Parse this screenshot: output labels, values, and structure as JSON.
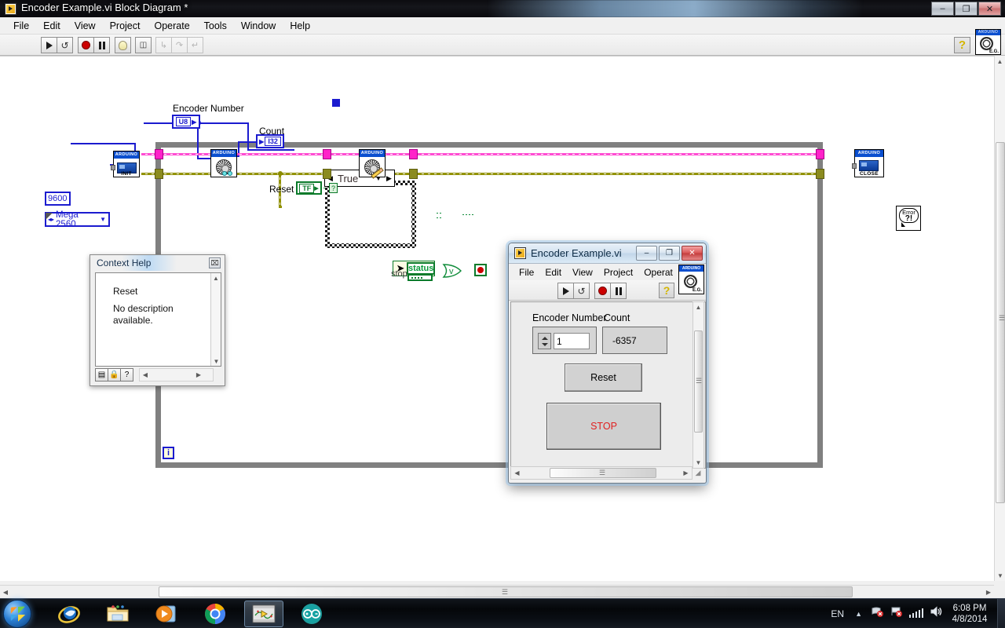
{
  "block_diagram_window": {
    "title": "Encoder Example.vi Block Diagram *",
    "title_icon": "labview-vi-icon",
    "window_buttons": {
      "minimize": "–",
      "maximize": "❐",
      "close": "✕"
    },
    "menu": [
      "File",
      "Edit",
      "View",
      "Project",
      "Operate",
      "Tools",
      "Window",
      "Help"
    ],
    "toolbar": {
      "run": "run-arrow-icon",
      "run_continuously": "run-continuous-icon",
      "abort": "abort-stop-icon",
      "pause": "pause-icon",
      "highlight_execution": "lightbulb-icon",
      "retain_wire_values": "probe-icon",
      "step_into": "step-into-icon",
      "step_over": "step-over-icon",
      "step_out": "step-out-icon",
      "context_help": "?",
      "arduino_logo_top": "ARDUINO",
      "arduino_logo_bottom": "E.G."
    }
  },
  "diagram": {
    "baud_constant": "9600",
    "board_control": "Mega 2560",
    "encoder_number_label": "Encoder Number",
    "encoder_number_type": "U8",
    "count_label": "Count",
    "count_type": "I32",
    "reset_label": "Reset",
    "reset_type": "TF",
    "case_selector_value": "True",
    "case_selector_left": "◀",
    "case_selector_right": "▶",
    "case_selector_down": "▼",
    "status_label": "status",
    "stop_label": "stop",
    "or_gate_label": "v",
    "iteration_terminal": "i",
    "init_vi_label": "INIT",
    "init_vi_header": "ARDUINO",
    "encoder_read_vi_header": "ARDUINO",
    "encoder_write_vi_header": "ARDUINO",
    "close_vi_label": "CLOSE",
    "close_vi_header": "ARDUINO",
    "error_handler_text": "Error",
    "error_handler_glyph": "?!",
    "colors": {
      "error_wire": "#9c9c00",
      "arduino_refnum_wire": "#ff4dd2",
      "numeric_wire": "#1b1bcf",
      "boolean_wire": "#108c3a",
      "structure_border": "#808080"
    }
  },
  "context_help": {
    "title": "Context Help",
    "close_label": "⌧",
    "item_name": "Reset",
    "description": "No description available.",
    "buttons": [
      "show-hide-optional-icon",
      "lock-icon",
      "detailed-help-icon"
    ]
  },
  "front_panel_window": {
    "title": "Encoder Example.vi",
    "window_buttons": {
      "minimize": "–",
      "maximize": "❐",
      "close": "✕"
    },
    "menu": [
      "File",
      "Edit",
      "View",
      "Project",
      "Operat"
    ],
    "toolbar": {
      "run": "run-arrow-icon",
      "run_continuously": "run-continuous-icon",
      "abort": "abort-stop-icon",
      "pause": "pause-icon",
      "context_help": "?",
      "arduino_logo_top": "ARDUINO",
      "arduino_logo_bottom": "E.G."
    },
    "controls": {
      "encoder_number_label": "Encoder Number",
      "encoder_number_value": "1",
      "count_label": "Count",
      "count_value": "-6357",
      "reset_button": "Reset",
      "stop_button": "STOP"
    }
  },
  "taskbar": {
    "start": "windows-start-orb",
    "items": [
      {
        "name": "internet-explorer",
        "active": false
      },
      {
        "name": "windows-explorer",
        "active": false
      },
      {
        "name": "windows-media-player",
        "active": false
      },
      {
        "name": "google-chrome",
        "active": false
      },
      {
        "name": "labview",
        "active": true
      },
      {
        "name": "arduino-ide",
        "active": false
      }
    ],
    "language": "EN",
    "tray_icons": [
      "network-error-icon",
      "action-center-flag-icon",
      "signal-bars-icon",
      "volume-icon"
    ],
    "time": "6:08 PM",
    "date": "4/8/2014"
  }
}
